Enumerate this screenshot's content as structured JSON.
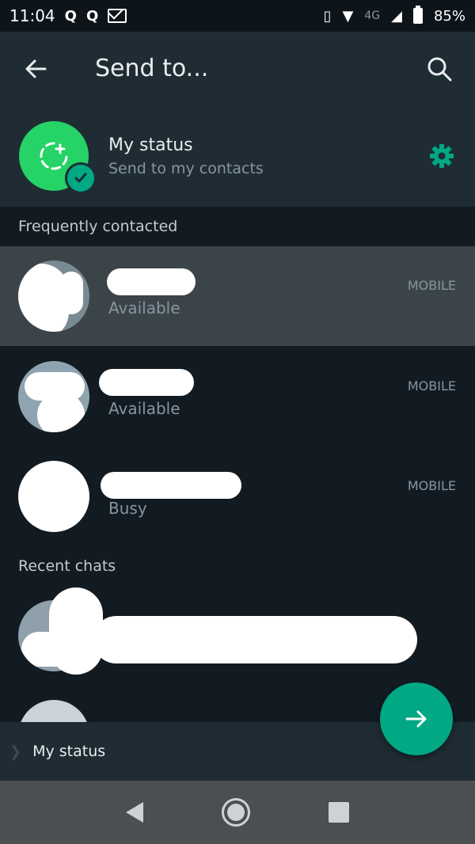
{
  "status_bar": {
    "time": "11:04",
    "network": "4G",
    "battery": "85%"
  },
  "app_bar": {
    "title": "Send to..."
  },
  "my_status": {
    "name": "My status",
    "subtitle": "Send to my contacts"
  },
  "sections": {
    "frequent": "Frequently contacted",
    "recent": "Recent chats"
  },
  "contacts": [
    {
      "status": "Available",
      "type": "MOBILE"
    },
    {
      "status": "Available",
      "type": "MOBILE"
    },
    {
      "status": "Busy",
      "type": "MOBILE"
    }
  ],
  "bottom_bar": {
    "label": "My status"
  },
  "colors": {
    "accent": "#00a884",
    "status_green": "#25d366",
    "header": "#1f2c34",
    "background": "#121b22"
  }
}
